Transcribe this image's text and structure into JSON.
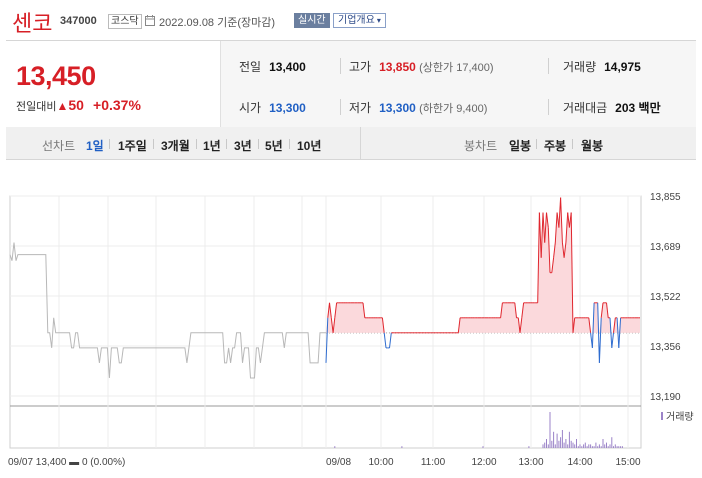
{
  "header": {
    "name": "센코",
    "code": "347000",
    "market": "코스닥",
    "date_text": "2022.09.08 기준(장마감)",
    "realtime_label": "실시간",
    "company_label": "기업개요"
  },
  "price": {
    "current": "13,450",
    "change_label": "전일대비",
    "change_amount": "50",
    "change_pct": "+0.37%"
  },
  "info": {
    "prev_label": "전일",
    "prev_value": "13,400",
    "high_label": "고가",
    "high_value": "13,850",
    "upper_limit": "(상한가 17,400)",
    "volume_label": "거래량",
    "volume_value": "14,975",
    "open_label": "시가",
    "open_value": "13,300",
    "low_label": "저가",
    "low_value": "13,300",
    "lower_limit": "(하한가 9,400)",
    "amount_label": "거래대금",
    "amount_value": "203 백만"
  },
  "periods": {
    "line_label": "선차트",
    "line_items": [
      "1일",
      "1주일",
      "3개월",
      "1년",
      "3년",
      "5년",
      "10년"
    ],
    "active_index": 0,
    "candle_label": "봉차트",
    "candle_items": [
      "일봉",
      "주봉",
      "월봉"
    ]
  },
  "chart_data": {
    "type": "line",
    "y_ticks": [
      "13,855",
      "13,689",
      "13,522",
      "13,356",
      "13,190"
    ],
    "ylim": [
      13190,
      13855
    ],
    "baseline": 13400,
    "x_labels": [
      "09/08",
      "10:00",
      "11:00",
      "12:00",
      "13:00",
      "14:00",
      "15:00"
    ],
    "footer_text": "09/07 13,400 ▬ 0 (0.00%)",
    "volume_legend": "거래량",
    "prev_day_series": [
      13660,
      13640,
      13700,
      13640,
      13660,
      13660,
      13660,
      13660,
      13660,
      13660,
      13660,
      13660,
      13660,
      13660,
      13660,
      13660,
      13660,
      13660,
      13660,
      13400,
      13400,
      13350,
      13450,
      13400,
      13400,
      13400,
      13400,
      13400,
      13400,
      13400,
      13400,
      13350,
      13350,
      13400,
      13400,
      13350,
      13350,
      13350,
      13350,
      13350,
      13350,
      13350,
      13350,
      13350,
      13350,
      13300,
      13350,
      13350,
      13350,
      13350,
      13250,
      13350,
      13350,
      13350,
      13350,
      13300,
      13300,
      13350,
      13350,
      13350,
      13350,
      13350,
      13350,
      13350,
      13350,
      13350,
      13350,
      13350,
      13350,
      13350,
      13350,
      13350,
      13350,
      13350,
      13350,
      13350,
      13350,
      13350,
      13350,
      13350,
      13350,
      13350,
      13350,
      13350,
      13350,
      13350,
      13350,
      13350,
      13350,
      13300,
      13350,
      13400,
      13400,
      13400,
      13400,
      13400,
      13400,
      13400,
      13400,
      13400,
      13400,
      13400,
      13400,
      13400,
      13400,
      13400,
      13400,
      13400,
      13300,
      13300,
      13350,
      13300,
      13350,
      13350,
      13400,
      13400,
      13400,
      13300,
      13350,
      13350,
      13350,
      13250,
      13250,
      13250,
      13350,
      13350,
      13300,
      13350,
      13400,
      13400,
      13400,
      13400,
      13400,
      13400,
      13400,
      13400,
      13400,
      13400,
      13350,
      13400,
      13400,
      13400,
      13400,
      13400,
      13400,
      13400,
      13400,
      13400,
      13400,
      13400,
      13400,
      13300,
      13300,
      13300,
      13300,
      13300,
      13400,
      13400,
      13400,
      13400
    ],
    "day_series": [
      13300,
      13450,
      13500,
      13450,
      13400,
      13450,
      13500,
      13500,
      13500,
      13500,
      13500,
      13500,
      13500,
      13500,
      13500,
      13500,
      13500,
      13500,
      13500,
      13500,
      13500,
      13500,
      13450,
      13450,
      13450,
      13450,
      13450,
      13450,
      13450,
      13450,
      13450,
      13450,
      13450,
      13400,
      13350,
      13350,
      13350,
      13400,
      13400,
      13400,
      13400,
      13400,
      13400,
      13400,
      13400,
      13400,
      13400,
      13400,
      13400,
      13400,
      13400,
      13400,
      13400,
      13400,
      13400,
      13400,
      13400,
      13400,
      13400,
      13400,
      13400,
      13400,
      13400,
      13400,
      13400,
      13400,
      13400,
      13400,
      13400,
      13400,
      13400,
      13400,
      13400,
      13400,
      13400,
      13400,
      13450,
      13450,
      13450,
      13450,
      13450,
      13450,
      13450,
      13450,
      13450,
      13450,
      13450,
      13450,
      13450,
      13450,
      13450,
      13450,
      13450,
      13450,
      13450,
      13450,
      13450,
      13450,
      13450,
      13450,
      13500,
      13500,
      13500,
      13500,
      13500,
      13500,
      13500,
      13500,
      13450,
      13450,
      13400,
      13450,
      13500,
      13500,
      13500,
      13500,
      13500,
      13500,
      13500,
      13500,
      13500,
      13800,
      13650,
      13800,
      13700,
      13800,
      13750,
      13600,
      13600,
      13650,
      13700,
      13800,
      13750,
      13850,
      13700,
      13650,
      13700,
      13800,
      13750,
      13800,
      13400,
      13450,
      13450,
      13450,
      13450,
      13450,
      13450,
      13450,
      13450,
      13450,
      13400,
      13350,
      13500,
      13500,
      13500,
      13300,
      13450,
      13500,
      13500,
      13500,
      13450,
      13450,
      13350,
      13400,
      13450,
      13450,
      13350,
      13450,
      13450,
      13450,
      13450,
      13450,
      13450,
      13450,
      13450,
      13450,
      13450,
      13450,
      13450
    ],
    "volume": [
      0,
      0,
      0,
      0,
      0,
      1,
      0,
      0,
      0,
      0,
      0,
      0,
      0,
      0,
      0,
      0,
      0,
      0,
      0,
      0,
      0,
      0,
      0,
      0,
      0,
      0,
      0,
      0,
      0,
      0,
      0,
      0,
      0,
      0,
      0,
      0,
      0,
      0,
      0,
      0,
      0,
      0,
      0,
      1,
      0,
      0,
      0,
      0,
      0,
      0,
      0,
      0,
      0,
      0,
      0,
      0,
      0,
      0,
      0,
      0,
      0,
      0,
      0,
      0,
      0,
      0,
      0,
      0,
      0,
      0,
      0,
      0,
      0,
      0,
      0,
      0,
      0,
      0,
      0,
      0,
      0,
      0,
      0,
      0,
      0,
      0,
      0,
      0,
      0,
      1,
      0,
      0,
      0,
      0,
      0,
      0,
      0,
      0,
      0,
      0,
      0,
      0,
      0,
      0,
      0,
      0,
      0,
      0,
      0,
      0,
      0,
      0,
      0,
      0,
      0,
      1,
      0,
      0,
      0,
      0,
      0,
      0,
      0,
      2,
      3,
      5,
      2,
      20,
      4,
      9,
      2,
      8,
      4,
      6,
      10,
      3,
      5,
      2,
      9,
      4,
      3,
      2,
      5,
      1,
      2,
      1,
      2,
      3,
      1,
      2,
      2,
      1,
      1,
      3,
      1,
      2,
      1,
      5,
      2,
      3,
      1,
      2,
      6,
      1,
      2,
      1,
      1,
      1,
      1,
      0,
      0,
      0,
      0,
      0,
      0,
      0,
      0,
      0
    ]
  }
}
